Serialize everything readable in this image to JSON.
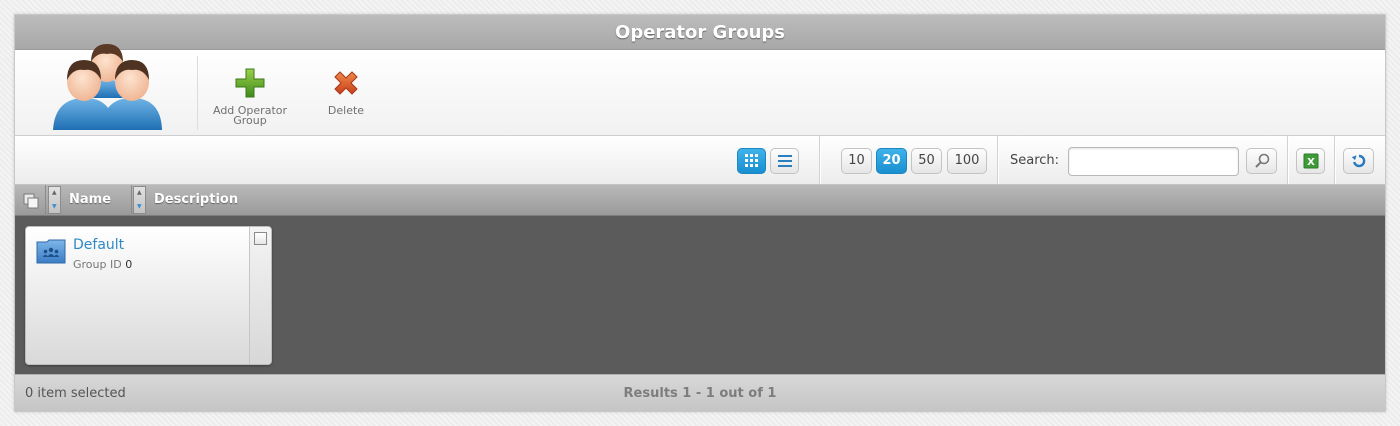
{
  "header": {
    "title": "Operator Groups"
  },
  "toolbar": {
    "add_label": "Add Operator Group",
    "delete_label": "Delete"
  },
  "view_mode": {
    "grid_active": true
  },
  "page_size": {
    "options": [
      "10",
      "20",
      "50",
      "100"
    ],
    "selected": "20"
  },
  "search": {
    "label": "Search:",
    "value": "",
    "placeholder": ""
  },
  "columns": [
    "Name",
    "Description"
  ],
  "items": [
    {
      "name": "Default",
      "id_label": "Group ID",
      "id_value": "0",
      "checked": false
    }
  ],
  "footer": {
    "selection": "0 item selected",
    "results": "Results 1 - 1 out of 1"
  },
  "colors": {
    "accent": "#1a8fd0",
    "link": "#2d8ac7",
    "content_bg": "#5b5b5b"
  }
}
